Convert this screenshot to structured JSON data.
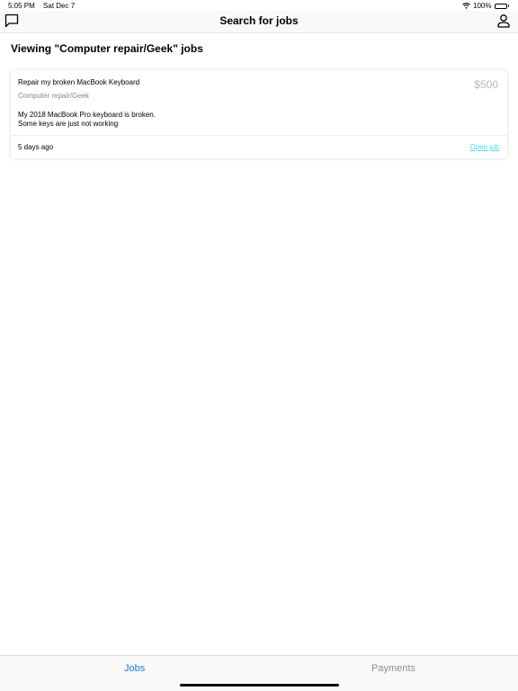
{
  "status": {
    "time": "5:05 PM",
    "date": "Sat Dec 7",
    "battery": "100%",
    "icons": [
      "wifi-icon",
      "battery-icon"
    ]
  },
  "nav": {
    "title": "Search for jobs",
    "left_icon": "chat-bubble-icon",
    "right_icon": "profile-icon"
  },
  "page": {
    "heading": "Viewing \"Computer repair/Geek\" jobs"
  },
  "jobs": [
    {
      "title": "Repair my broken MacBook Keyboard",
      "price": "$500",
      "category": "Computer repair/Geek",
      "description": "My 2018 MacBook Pro keyboard is broken.\nSome keys are just not working",
      "age": "5 days ago",
      "action_label": "Open job"
    }
  ],
  "tabs": [
    {
      "label": "Jobs",
      "active": true
    },
    {
      "label": "Payments",
      "active": false
    }
  ],
  "colors": {
    "active_tab": "#1e7ff0",
    "inactive_tab": "#8e8e8e",
    "link": "#5ad2e8",
    "price": "#b7b7b7"
  }
}
